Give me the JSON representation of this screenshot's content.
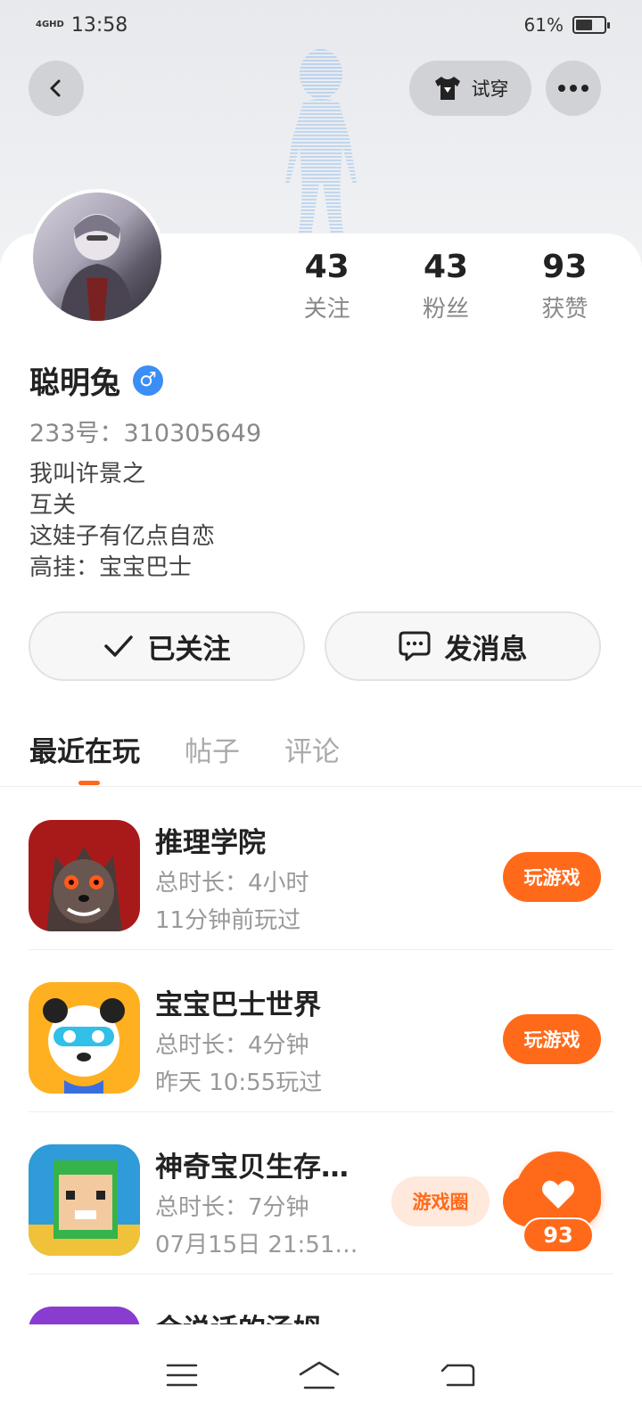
{
  "status_bar": {
    "network": "4GHD",
    "time": "13:58",
    "battery": "61%",
    "battery_level": 0.61
  },
  "header": {
    "try_on_label": "试穿"
  },
  "profile": {
    "stats": [
      {
        "value": "43",
        "label": "关注"
      },
      {
        "value": "43",
        "label": "粉丝"
      },
      {
        "value": "93",
        "label": "获赞"
      }
    ],
    "name": "聪明兔",
    "gender_symbol": "♂",
    "uid": "233号：310305649",
    "bio": [
      "我叫许景之",
      "互关",
      "这娃子有亿点自恋",
      "高挂：宝宝巴士"
    ]
  },
  "actions": {
    "follow_label": "已关注",
    "message_label": "发消息"
  },
  "tabs": [
    "最近在玩",
    "帖子",
    "评论"
  ],
  "games": [
    {
      "name": "推理学院",
      "duration": "总时长：4小时",
      "last_played": "11分钟前玩过",
      "button": "玩游戏",
      "icon": "werewolf-game-icon"
    },
    {
      "name": "宝宝巴士世界",
      "duration": "总时长：4分钟",
      "last_played": "昨天 10:55玩过",
      "button": "玩游戏",
      "icon": "panda-game-icon"
    },
    {
      "name": "神奇宝贝生存…",
      "duration": "总时长：7分钟",
      "last_played": "07月15日 21:51…",
      "button": "游戏圈",
      "icon": "block-character-game-icon"
    },
    {
      "name": "会说话的汤姆…",
      "icon": "tom-cat-game-icon"
    }
  ],
  "like": {
    "count": "93"
  },
  "colors": {
    "accent": "#ff6a1a",
    "gender": "#3a8ef6"
  }
}
